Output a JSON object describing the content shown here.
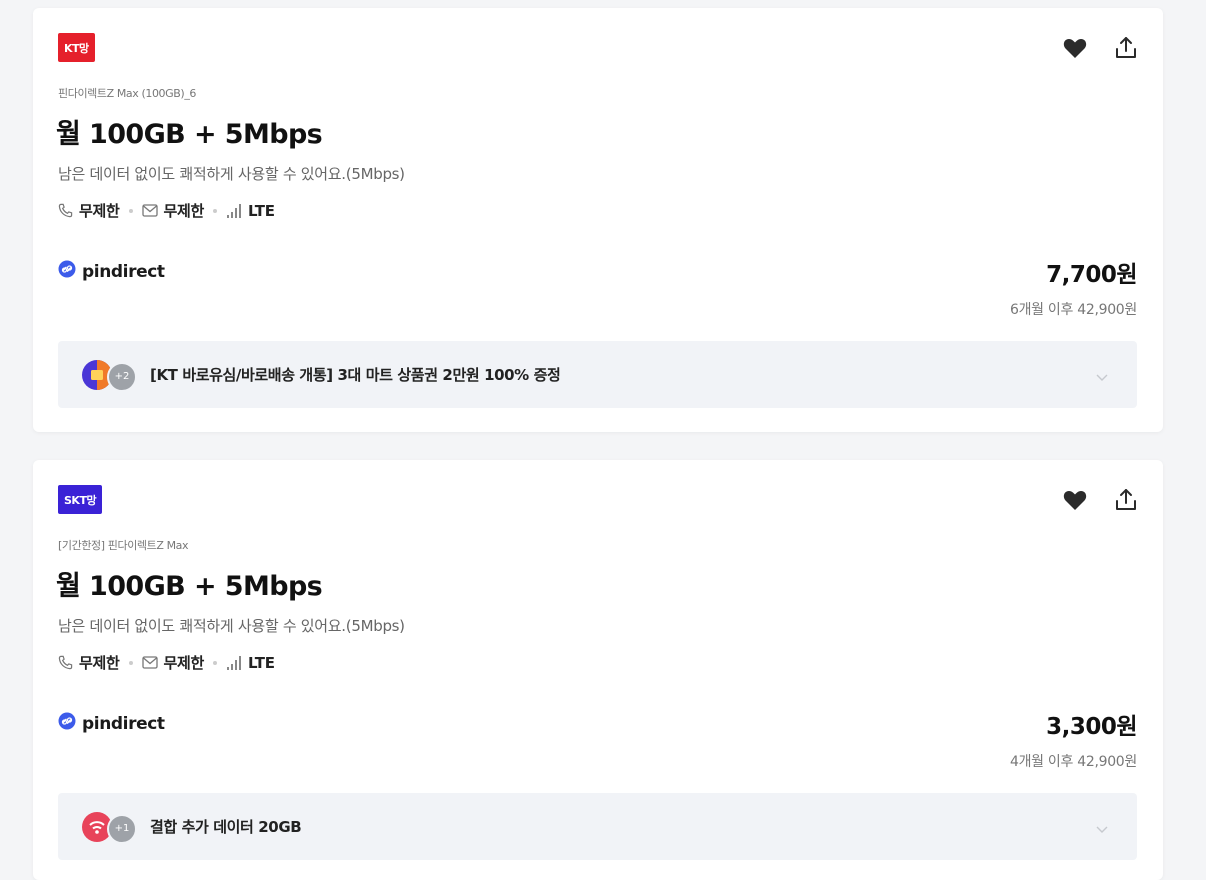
{
  "cards": [
    {
      "badge": "KT망",
      "badge_color": "#e5202b",
      "plan_name": "핀다이렉트Z Max (100GB)_6",
      "title": "월 100GB + 5Mbps",
      "description": "남은 데이터 없이도 쾌적하게 사용할 수 있어요.(5Mbps)",
      "calls": "무제한",
      "sms": "무제한",
      "network": "LTE",
      "provider": "pindirect",
      "price": "7,700원",
      "price_after": "6개월 이후 42,900원",
      "promo_count": "+2",
      "promo_text": "[KT 바로유심/바로배송 개통] 3대 마트 상품권 2만원 100% 증정"
    },
    {
      "badge": "SKT망",
      "badge_color": "#3a22d6",
      "plan_name": "[기간한정] 핀다이렉트Z Max",
      "title": "월 100GB + 5Mbps",
      "description": "남은 데이터 없이도 쾌적하게 사용할 수 있어요.(5Mbps)",
      "calls": "무제한",
      "sms": "무제한",
      "network": "LTE",
      "provider": "pindirect",
      "price": "3,300원",
      "price_after": "4개월 이후 42,900원",
      "promo_count": "+1",
      "promo_text": "결합 추가 데이터 20GB"
    }
  ],
  "icons": {
    "like": "heart-icon",
    "share": "share-icon",
    "call": "phone-icon",
    "sms": "mail-icon",
    "network": "signal-icon",
    "provider": "pindirect-logo-icon",
    "expand": "chevron-down-icon"
  }
}
